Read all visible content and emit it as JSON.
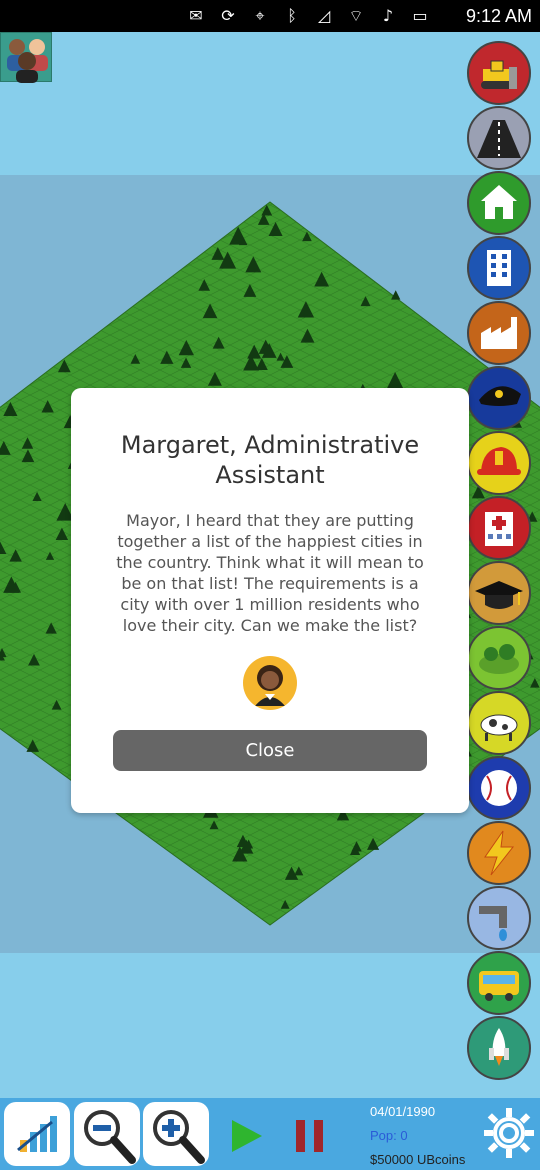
{
  "status_bar": {
    "time": "9:12 AM",
    "icons": [
      "mail-icon",
      "rotation-lock-icon",
      "location-icon",
      "bluetooth-icon",
      "cellular-icon",
      "wifi-icon",
      "volume-icon",
      "battery-icon"
    ]
  },
  "toolbar": {
    "tools": [
      {
        "name": "bulldozer",
        "color": "#c0282d"
      },
      {
        "name": "road",
        "color": "#9aa0b3"
      },
      {
        "name": "residential",
        "color": "#2f9b2c"
      },
      {
        "name": "commercial",
        "color": "#1e55b3"
      },
      {
        "name": "industrial",
        "color": "#c4651a"
      },
      {
        "name": "police",
        "color": "#173a9c"
      },
      {
        "name": "fire-station",
        "color": "#e6d21a"
      },
      {
        "name": "hospital",
        "color": "#c42026"
      },
      {
        "name": "school",
        "color": "#d29a3a"
      },
      {
        "name": "park",
        "color": "#7cc432"
      },
      {
        "name": "farm",
        "color": "#d6d826"
      },
      {
        "name": "stadium",
        "color": "#1e3cae"
      },
      {
        "name": "power",
        "color": "#e1891e"
      },
      {
        "name": "water",
        "color": "#98b7e3"
      },
      {
        "name": "transit",
        "color": "#2fa24a"
      },
      {
        "name": "space-port",
        "color": "#2e9a78"
      }
    ]
  },
  "dialog": {
    "title": "Margaret, Administrative Assistant",
    "message": "Mayor, I heard that they are putting together a list of the happiest cities in the country. Think what it will mean to be on that list! The requirements is a city with over 1 million residents who love their city. Can we make the list?",
    "close_label": "Close"
  },
  "bottom_bar": {
    "date": "04/01/1990",
    "population": "Pop: 0",
    "money": "$50000 UBcoins"
  },
  "colors": {
    "sky": "#87ceeb",
    "water": "#7fb6d4",
    "grass": "#3e9a2e",
    "bottom_bar": "#4aa8e0",
    "button_gray": "#666666"
  }
}
